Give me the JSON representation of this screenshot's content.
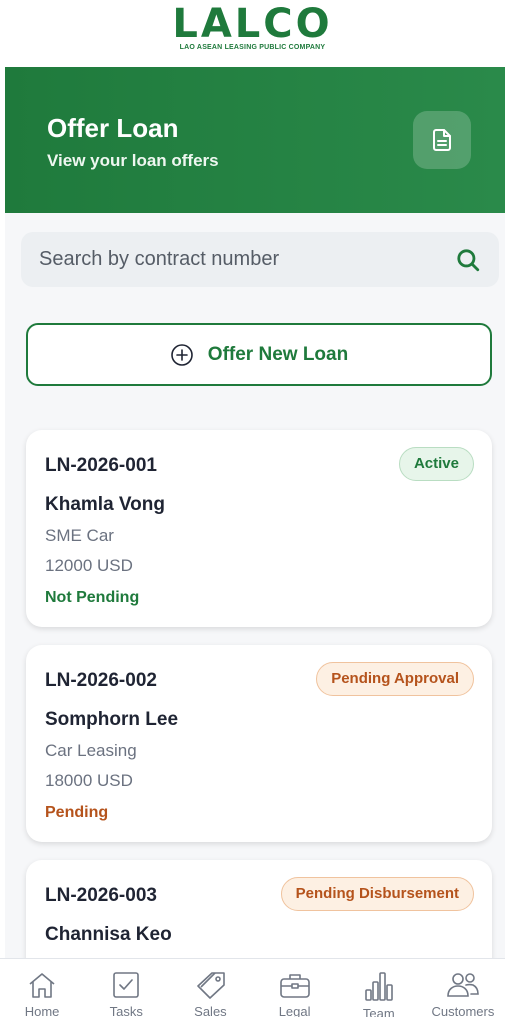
{
  "logo": {
    "word": "LALCO",
    "subtitle": "LAO ASEAN LEASING PUBLIC COMPANY"
  },
  "header": {
    "title": "Offer Loan",
    "subtitle": "View your loan offers",
    "action_icon": "document-icon"
  },
  "search": {
    "placeholder": "Search by contract number",
    "icon": "search-icon"
  },
  "offer_button": {
    "label": "Offer New Loan",
    "icon": "plus-circle-icon"
  },
  "loans": [
    {
      "id": "LN-2026-001",
      "name": "Khamla Vong",
      "type": "SME Car",
      "amount": "12000 USD",
      "badge": "Active",
      "status": "Not Pending"
    },
    {
      "id": "LN-2026-002",
      "name": "Somphorn Lee",
      "type": "Car Leasing",
      "amount": "18000 USD",
      "badge": "Pending Approval",
      "status": "Pending"
    },
    {
      "id": "LN-2026-003",
      "name": "Channisa Keo",
      "type": "",
      "amount": "",
      "badge": "Pending Disbursement",
      "status": ""
    }
  ],
  "nav": [
    {
      "label": "Home",
      "icon": "home-icon"
    },
    {
      "label": "Tasks",
      "icon": "checkbox-icon"
    },
    {
      "label": "Sales",
      "icon": "tag-icon"
    },
    {
      "label": "Legal",
      "icon": "briefcase-icon"
    },
    {
      "label": "Team",
      "icon": "bar-chart-icon"
    },
    {
      "label": "Customers",
      "icon": "users-icon"
    }
  ],
  "colors": {
    "brand_green": "#1f7a3c",
    "pending_orange": "#b5531c",
    "background": "#f6f7f9"
  }
}
